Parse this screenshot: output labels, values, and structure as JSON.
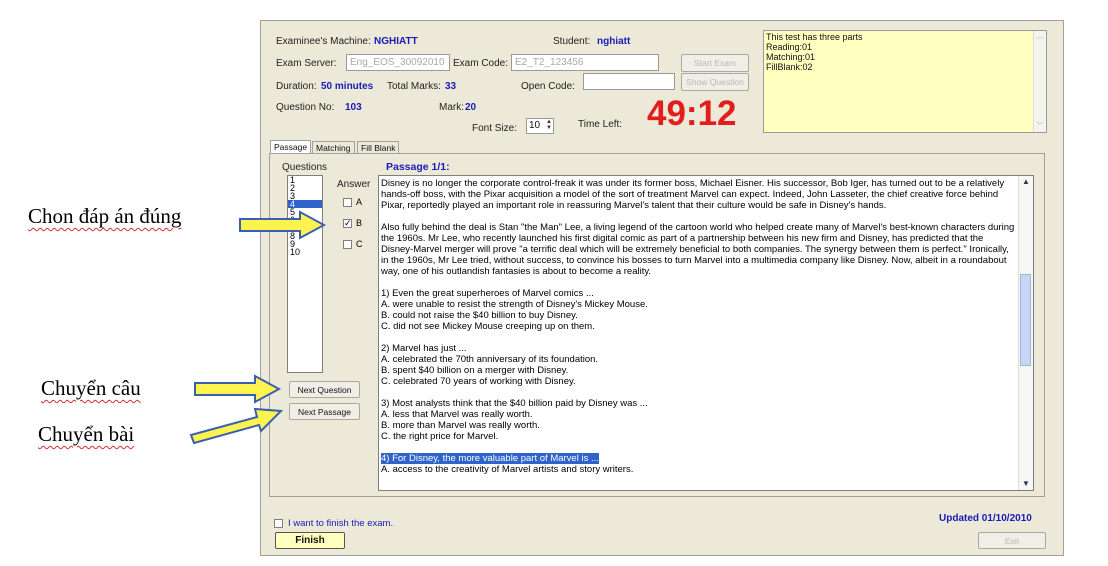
{
  "header": {
    "machine_label": "Examinee's Machine:",
    "machine_value": "NGHIATT",
    "student_label": "Student:",
    "student_value": "nghiatt",
    "server_label": "Exam Server:",
    "server_value": "Eng_EOS_30092010",
    "exam_code_label": "Exam Code:",
    "exam_code_value": "E2_T2_123456",
    "start_exam": "Start Exam",
    "duration_label": "Duration:",
    "duration_value": "50 minutes",
    "total_marks_label": "Total Marks:",
    "total_marks_value": "33",
    "open_code_label": "Open Code:",
    "show_question": "Show Question",
    "question_no_label": "Question No:",
    "question_no_value": "103",
    "mark_label": "Mark:",
    "mark_value": "20",
    "font_size_label": "Font Size:",
    "font_size_value": "10",
    "time_left_label": "Time Left:",
    "timer": "49:12"
  },
  "info_box": [
    "This test has three parts",
    "Reading:01",
    "Matching:01",
    "FillBlank:02"
  ],
  "tabs": [
    "Passage",
    "Matching",
    "Fill Blank"
  ],
  "questions_label": "Questions",
  "questions": [
    "1",
    "2",
    "3",
    "4",
    "5",
    "6",
    "7",
    "8",
    "9",
    "10"
  ],
  "selected_question_index": 3,
  "answer_label": "Answer",
  "answers": [
    {
      "label": "A",
      "checked": false
    },
    {
      "label": "B",
      "checked": true
    },
    {
      "label": "C",
      "checked": false
    }
  ],
  "passage_title": "Passage 1/1:",
  "passage_paragraphs": [
    "Disney is no longer the corporate control-freak it was under its former boss, Michael Eisner. His successor, Bob Iger, has turned out to be a relatively hands-off boss, with the Pixar acquisition a model of the sort of treatment Marvel can expect. Indeed, John Lasseter, the chief creative force behind Pixar, reportedly played an important role in reassuring Marvel's talent that their culture would be safe in Disney's hands.",
    "Also fully behind the deal is Stan \"the Man\" Lee, a living legend of the cartoon world who helped create many of Marvel's best-known characters during the 1960s. Mr Lee, who recently launched his first digital comic as part of a partnership between his new firm and Disney, has predicted that the Disney-Marvel merger will prove \"a terrific deal which will be extremely beneficial to both companies. The synergy between them is perfect.\" Ironically, in the 1960s, Mr Lee tried, without success, to convince his bosses to turn Marvel into a multimedia company like Disney. Now, albeit in a roundabout way, one of his outlandish fantasies is about to become a reality.",
    "1) Even the great superheroes of Marvel comics ...\nA. were unable to resist the strength of Disney's Mickey Mouse.\nB. could not raise the $40  billion to buy Disney.\nC. did not see Mickey Mouse creeping up on them.",
    "2) Marvel has just ...\nA. celebrated the 70th  anniversary of its foundation.\nB. spent $40 billion on a merger with Disney.\nC. celebrated 70 years of working with Disney.",
    "3) Most analysts think that the $40 billion paid by Disney was ...\nA. less that Marvel was really worth.\nB. more than Marvel was really worth.\nC. the right price for Marvel."
  ],
  "passage_highlight": "4) For Disney, the more valuable part of Marvel is ...",
  "passage_after_highlight": "A. access to the creativity of Marvel artists and story writers.",
  "buttons": {
    "next_question": "Next Question",
    "next_passage": "Next Passage",
    "finish": "Finish",
    "exit": "Exit"
  },
  "finish_checkbox_label": "I want to finish the exam.",
  "updated": "Updated 01/10/2010",
  "annotations": {
    "choose_answer": "Chon đáp án đúng",
    "next_question": "Chuyển câu",
    "next_passage": "Chuyển bài"
  },
  "colors": {
    "timer": "#e31c1c",
    "value_blue": "#1a1ab8",
    "info_box_bg": "#ffffc0",
    "selection": "#2e63c9",
    "arrow_fill": "#fff44f",
    "arrow_stroke": "#3b5fb0"
  }
}
